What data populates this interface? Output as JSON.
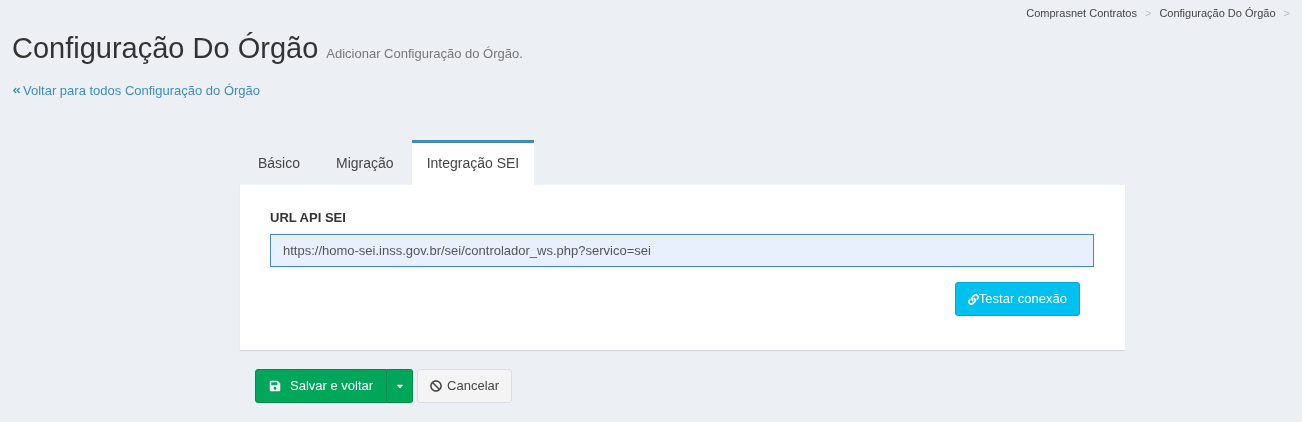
{
  "breadcrumb": {
    "items": [
      {
        "label": "Comprasnet Contratos"
      },
      {
        "label": "Configuração Do Órgão"
      }
    ],
    "separator": ">"
  },
  "header": {
    "title": "Configuração Do Órgão",
    "subtitle": "Adicionar Configuração do Órgão."
  },
  "back_link": {
    "label": "Voltar para todos Configuração do Órgão"
  },
  "tabs": [
    {
      "label": "Básico",
      "selected": false
    },
    {
      "label": "Migração",
      "selected": false
    },
    {
      "label": "Integração SEI",
      "selected": true
    }
  ],
  "form": {
    "field_label": "URL API SEI",
    "field_value": "https://homo-sei.inss.gov.br/sei/controlador_ws.php?servico=sei",
    "focused": true,
    "test_button": "Testar conexão"
  },
  "actions": {
    "save": "Salvar e voltar",
    "cancel": "Cancelar"
  }
}
